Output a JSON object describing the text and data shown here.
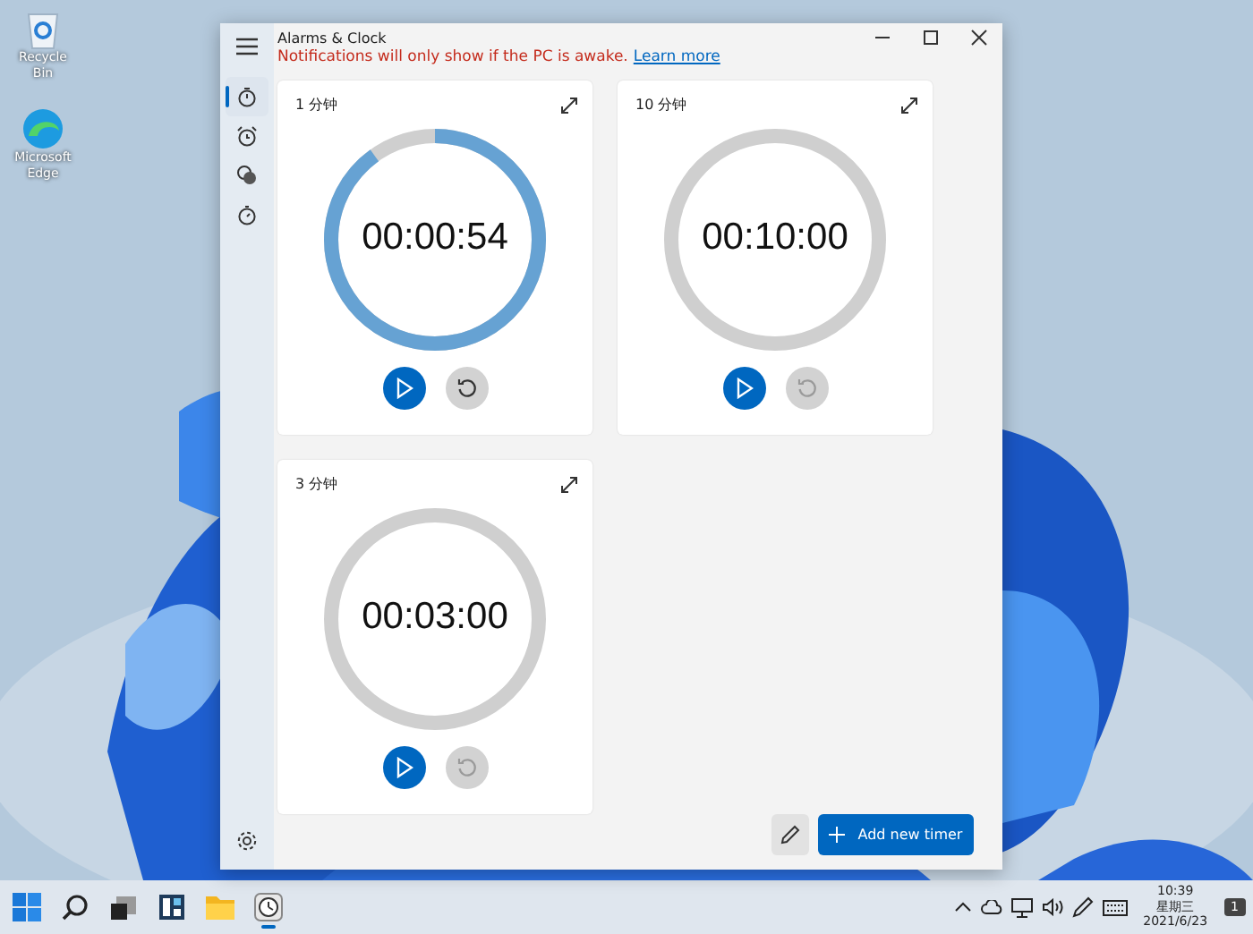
{
  "desktop_icons": [
    {
      "kind": "recycle",
      "label": "Recycle Bin"
    },
    {
      "kind": "edge",
      "label": "Microsoft Edge"
    }
  ],
  "window": {
    "title": "Alarms & Clock"
  },
  "nav": [
    {
      "kind": "timer",
      "selected": true
    },
    {
      "kind": "alarm",
      "selected": false
    },
    {
      "kind": "world",
      "selected": false
    },
    {
      "kind": "stopwatch",
      "selected": false
    }
  ],
  "notice": {
    "text": "Notifications will only show if the PC is awake.",
    "link": "Learn more"
  },
  "timers": [
    {
      "name": "1 分钟",
      "time": "00:00:54",
      "level": 0.9,
      "reset_enabled": true
    },
    {
      "name": "10 分钟",
      "time": "00:10:00",
      "reset_enabled": false
    },
    {
      "name": "3 分钟",
      "time": "00:03:00",
      "reset_enabled": false
    }
  ],
  "add_button": "Add new timer",
  "taskbar": {
    "apps": [
      {
        "kind": "start",
        "running": false
      },
      {
        "kind": "search",
        "running": false
      },
      {
        "kind": "taskview",
        "running": false
      },
      {
        "kind": "widgets",
        "running": false
      },
      {
        "kind": "folder",
        "running": false
      },
      {
        "kind": "clock",
        "running": true
      }
    ],
    "time": "10:39",
    "weekday": "星期三",
    "date": "2021/6/23",
    "notifications": "1"
  }
}
